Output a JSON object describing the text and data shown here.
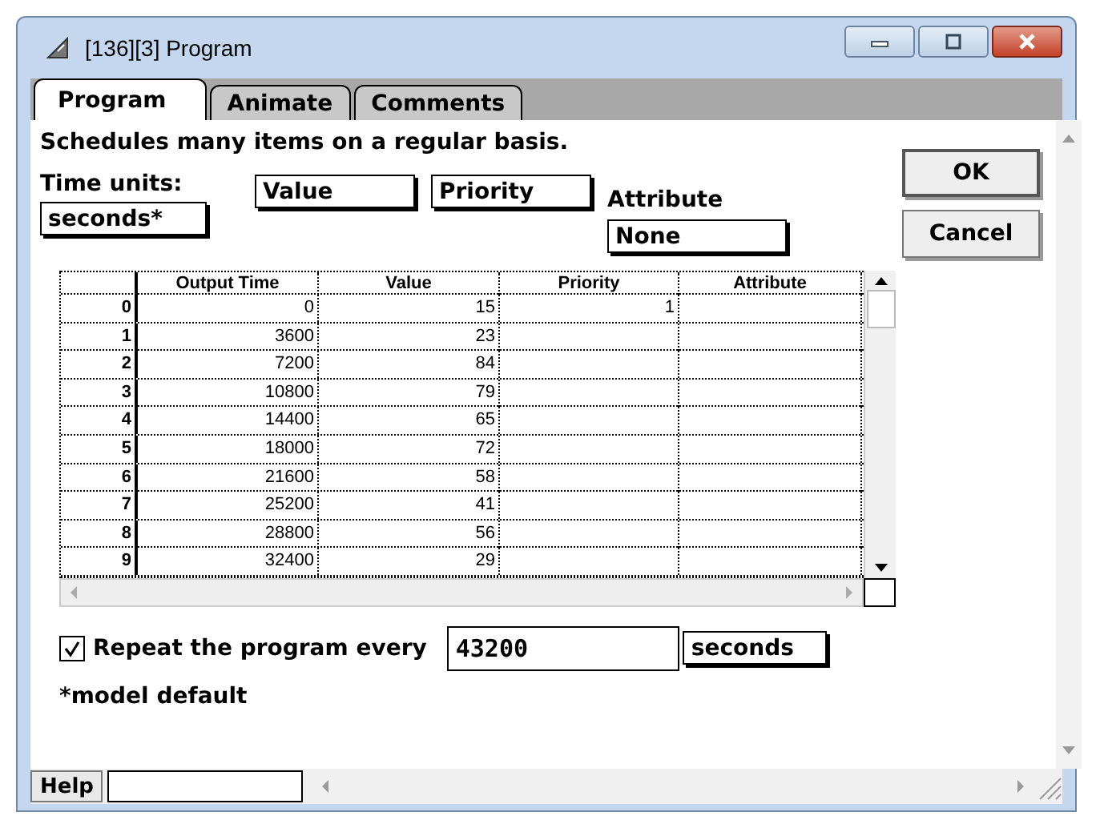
{
  "window": {
    "title": "[136][3]  Program"
  },
  "tabs": [
    {
      "label": "Program",
      "selected": true
    },
    {
      "label": "Animate",
      "selected": false
    },
    {
      "label": "Comments",
      "selected": false
    }
  ],
  "description": "Schedules many items on a regular basis.",
  "time_units": {
    "label": "Time units:",
    "value": "seconds*"
  },
  "column_popups": [
    {
      "value": "Value"
    },
    {
      "value": "Priority"
    }
  ],
  "attribute": {
    "label": "Attribute",
    "value": "None"
  },
  "buttons": [
    {
      "label": "OK",
      "default": true
    },
    {
      "label": "Cancel",
      "default": false
    }
  ],
  "table": {
    "columns": [
      "Output Time",
      "Value",
      "Priority",
      "Attribute"
    ],
    "rows": [
      {
        "index": "0",
        "cells": [
          "0",
          "15",
          "1",
          ""
        ]
      },
      {
        "index": "1",
        "cells": [
          "3600",
          "23",
          "",
          ""
        ]
      },
      {
        "index": "2",
        "cells": [
          "7200",
          "84",
          "",
          ""
        ]
      },
      {
        "index": "3",
        "cells": [
          "10800",
          "79",
          "",
          ""
        ]
      },
      {
        "index": "4",
        "cells": [
          "14400",
          "65",
          "",
          ""
        ]
      },
      {
        "index": "5",
        "cells": [
          "18000",
          "72",
          "",
          ""
        ]
      },
      {
        "index": "6",
        "cells": [
          "21600",
          "58",
          "",
          ""
        ]
      },
      {
        "index": "7",
        "cells": [
          "25200",
          "41",
          "",
          ""
        ]
      },
      {
        "index": "8",
        "cells": [
          "28800",
          "56",
          "",
          ""
        ]
      },
      {
        "index": "9",
        "cells": [
          "32400",
          "29",
          "",
          ""
        ]
      }
    ]
  },
  "repeat": {
    "label": "Repeat the program every",
    "checked": true,
    "value": "43200",
    "unit": "seconds"
  },
  "footnote": "*model default",
  "help_button": "Help"
}
